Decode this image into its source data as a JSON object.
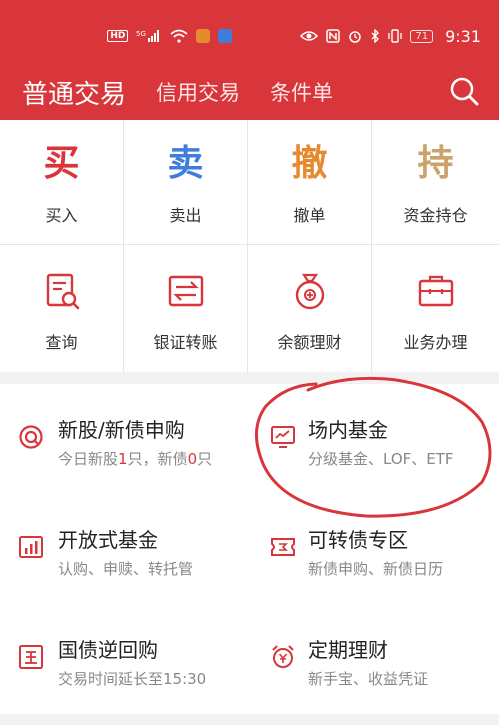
{
  "status": {
    "hd": "HD",
    "sig": "5G",
    "battery": "71",
    "time": "9:31"
  },
  "tabs": [
    {
      "label": "普通交易"
    },
    {
      "label": "信用交易"
    },
    {
      "label": "条件单"
    }
  ],
  "grid": [
    {
      "glyph": "买",
      "label": "买入",
      "color": "#d8363a"
    },
    {
      "glyph": "卖",
      "label": "卖出",
      "color": "#3f7ddc"
    },
    {
      "glyph": "撤",
      "label": "撤单",
      "color": "#e58a2f"
    },
    {
      "glyph": "持",
      "label": "资金持仓",
      "color": "#c9a36a"
    },
    {
      "label": "查询",
      "icon": "query-icon"
    },
    {
      "label": "银证转账",
      "icon": "transfer-icon"
    },
    {
      "label": "余额理财",
      "icon": "money-bag-icon"
    },
    {
      "label": "业务办理",
      "icon": "briefcase-icon"
    }
  ],
  "list": [
    {
      "title": "新股/新债申购",
      "sub_pre": "今日新股",
      "sub_num": "1",
      "sub_mid": "只，新债",
      "sub_num2": "0",
      "sub_post": "只",
      "icon": "ipo-icon"
    },
    {
      "title": "场内基金",
      "sub": "分级基金、LOF、ETF",
      "icon": "fund-chart-icon"
    },
    {
      "title": "开放式基金",
      "sub": "认购、申赎、转托管",
      "icon": "open-fund-icon"
    },
    {
      "title": "可转债专区",
      "sub": "新债申购、新债日历",
      "icon": "bond-icon"
    },
    {
      "title": "国债逆回购",
      "sub": "交易时间延长至15:30",
      "icon": "national-debt-icon"
    },
    {
      "title": "定期理财",
      "sub": "新手宝、收益凭证",
      "icon": "alarm-yen-icon"
    }
  ]
}
